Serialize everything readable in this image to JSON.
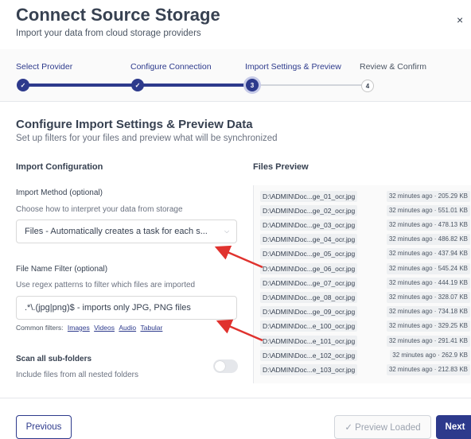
{
  "header": {
    "title": "Connect Source Storage",
    "subtitle": "Import your data from cloud storage providers",
    "close_icon": "×"
  },
  "steps": [
    {
      "label": "Select Provider",
      "status": "done",
      "marker": "✓"
    },
    {
      "label": "Configure Connection",
      "status": "done",
      "marker": "✓"
    },
    {
      "label": "Import Settings & Preview",
      "status": "current",
      "marker": "3"
    },
    {
      "label": "Review & Confirm",
      "status": "upcoming",
      "marker": "4"
    }
  ],
  "main": {
    "title": "Configure Import Settings & Preview Data",
    "subtitle": "Set up filters for your files and preview what will be synchronized"
  },
  "config": {
    "heading": "Import Configuration",
    "import_method": {
      "label": "Import Method (optional)",
      "hint": "Choose how to interpret your data from storage",
      "value": "Files - Automatically creates a task for each s..."
    },
    "file_filter": {
      "label": "File Name Filter (optional)",
      "hint": "Use regex patterns to filter which files are imported",
      "value": ".*\\.(jpg|png)$ - imports only JPG, PNG files"
    },
    "common_filters": {
      "label": "Common filters:",
      "options": [
        "Images",
        "Videos",
        "Audio",
        "Tabular"
      ]
    },
    "scan_subfolders": {
      "label": "Scan all sub-folders",
      "hint": "Include files from all nested folders",
      "enabled": false
    }
  },
  "preview": {
    "heading": "Files Preview",
    "files": [
      {
        "name": "D:\\ADMIN\\Doc...ge_01_ocr.jpg",
        "meta": "32 minutes ago · 205.29 KB"
      },
      {
        "name": "D:\\ADMIN\\Doc...ge_02_ocr.jpg",
        "meta": "32 minutes ago · 551.01 KB"
      },
      {
        "name": "D:\\ADMIN\\Doc...ge_03_ocr.jpg",
        "meta": "32 minutes ago · 478.13 KB"
      },
      {
        "name": "D:\\ADMIN\\Doc...ge_04_ocr.jpg",
        "meta": "32 minutes ago · 486.82 KB"
      },
      {
        "name": "D:\\ADMIN\\Doc...ge_05_ocr.jpg",
        "meta": "32 minutes ago · 437.94 KB"
      },
      {
        "name": "D:\\ADMIN\\Doc...ge_06_ocr.jpg",
        "meta": "32 minutes ago · 545.24 KB"
      },
      {
        "name": "D:\\ADMIN\\Doc...ge_07_ocr.jpg",
        "meta": "32 minutes ago · 444.19 KB"
      },
      {
        "name": "D:\\ADMIN\\Doc...ge_08_ocr.jpg",
        "meta": "32 minutes ago · 328.07 KB"
      },
      {
        "name": "D:\\ADMIN\\Doc...ge_09_ocr.jpg",
        "meta": "32 minutes ago · 734.18 KB"
      },
      {
        "name": "D:\\ADMIN\\Doc...e_100_ocr.jpg",
        "meta": "32 minutes ago · 329.25 KB"
      },
      {
        "name": "D:\\ADMIN\\Doc...e_101_ocr.jpg",
        "meta": "32 minutes ago · 291.41 KB"
      },
      {
        "name": "D:\\ADMIN\\Doc...e_102_ocr.jpg",
        "meta": "32 minutes ago · 262.9 KB"
      },
      {
        "name": "D:\\ADMIN\\Doc...e_103_ocr.jpg",
        "meta": "32 minutes ago · 212.83 KB"
      }
    ]
  },
  "footer": {
    "previous": "Previous",
    "preview_loaded": "✓ Preview Loaded",
    "next": "Next"
  },
  "colors": {
    "accent": "#2d3a8c",
    "annotation_arrow": "#e0322e"
  }
}
